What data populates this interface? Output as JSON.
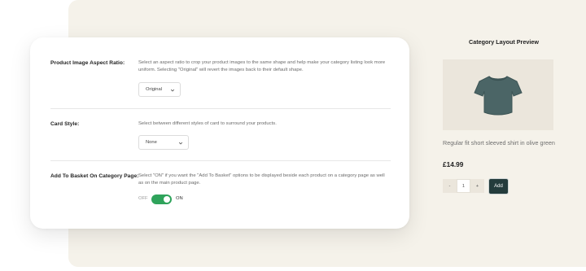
{
  "settings": {
    "rows": [
      {
        "label": "Product Image Aspect Ratio:",
        "description": "Select an aspect ratio to crop your product images to the same shape and help make your category listing look more uniform. Selecting \"Original\" will revert the images back to their default shape.",
        "select_value": "Original"
      },
      {
        "label": "Card Style:",
        "description": "Select between different styles of card to surround your products.",
        "select_value": "None"
      },
      {
        "label": "Add To Basket On Category Page:",
        "description": "Select \"ON\" if you want the \"Add To Basket\" options to be displayed beside each product on a category page as well as on the main product page.",
        "toggle_off_label": "OFF",
        "toggle_on_label": "ON",
        "toggle_state": "on"
      }
    ]
  },
  "preview": {
    "title": "Category Layout Preview",
    "product_name": "Regular fit short sleeved shirt in olive green",
    "price": "£14.99",
    "qty_minus": "-",
    "qty_value": "1",
    "qty_plus": "+",
    "add_label": "Add"
  },
  "colors": {
    "panel_bg": "#f5f2ea",
    "toggle_on": "#2fa35b",
    "add_button": "#243c3c",
    "shirt": "#4b6566"
  }
}
